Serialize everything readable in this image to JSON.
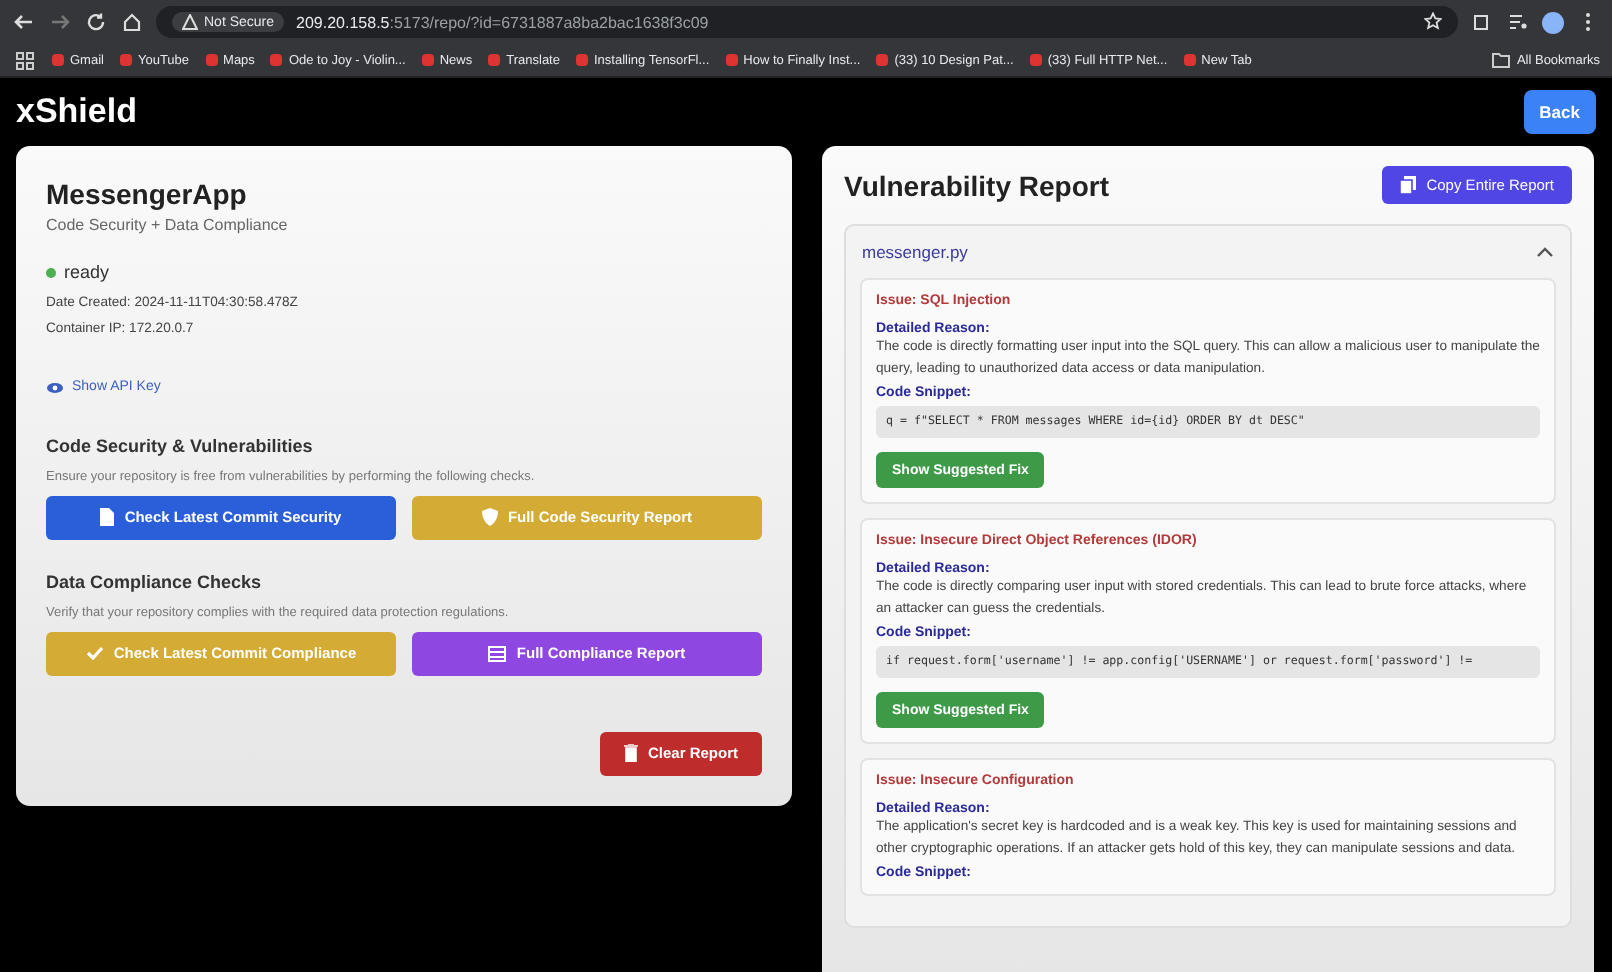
{
  "browser": {
    "security": "Not Secure",
    "url_host": "209.20.158.5",
    "url_rest": ":5173/repo/?id=6731887a8ba2bac1638f3c09",
    "bookmarks": [
      "Gmail",
      "YouTube",
      "Maps",
      "Ode to Joy - Violin...",
      "News",
      "Translate",
      "Installing TensorFl...",
      "How to Finally Inst...",
      "(33) 10 Design Pat...",
      "(33) Full HTTP Net...",
      "New Tab"
    ],
    "all_bookmarks": "All Bookmarks"
  },
  "header": {
    "brand": "xShield",
    "back": "Back"
  },
  "repo": {
    "name": "MessengerApp",
    "subtitle": "Code Security + Data Compliance",
    "status": "ready",
    "date_created": "Date Created: 2024-11-11T04:30:58.478Z",
    "container_ip": "Container IP: 172.20.0.7",
    "api_key_link": "Show API Key"
  },
  "sections": [
    {
      "title": "Code Security & Vulnerabilities",
      "description": "Ensure your repository is free from vulnerabilities by performing the following checks.",
      "buttons": [
        {
          "label": "Check Latest Commit Security",
          "kind": "blue"
        },
        {
          "label": "Full Code Security Report",
          "kind": "gold"
        }
      ]
    },
    {
      "title": "Data Compliance Checks",
      "description": "Verify that your repository complies with the required data protection regulations.",
      "buttons": [
        {
          "label": "Check Latest Commit Compliance",
          "kind": "gold"
        },
        {
          "label": "Full Compliance Report",
          "kind": "purple"
        }
      ]
    }
  ],
  "clear_button": "Clear Report",
  "report": {
    "title": "Vulnerability Report",
    "copy_button": "Copy Entire Report",
    "file": "messenger.py",
    "expanded": true,
    "issues": [
      {
        "title": "Issue: SQL Injection",
        "reason_label": "Detailed Reason:",
        "reason": "The code is directly formatting user input into the SQL query. This can allow a malicious user to manipulate the query, leading to unauthorized data access or data manipulation.",
        "snippet_label": "Code Snippet:",
        "snippet": "q = f\"SELECT * FROM messages WHERE id={id} ORDER BY dt DESC\"",
        "fix_button": "Show Suggested Fix"
      },
      {
        "title": "Issue: Insecure Direct Object References (IDOR)",
        "reason_label": "Detailed Reason:",
        "reason": "The code is directly comparing user input with stored credentials. This can lead to brute force attacks, where an attacker can guess the credentials.",
        "snippet_label": "Code Snippet:",
        "snippet": "if request.form['username'] != app.config['USERNAME'] or request.form['password'] !=",
        "fix_button": "Show Suggested Fix"
      },
      {
        "title": "Issue: Insecure Configuration",
        "reason_label": "Detailed Reason:",
        "reason": "The application's secret key is hardcoded and is a weak key. This key is used for maintaining sessions and other cryptographic operations. If an attacker gets hold of this key, they can manipulate sessions and data.",
        "snippet_label": "Code Snippet:"
      }
    ]
  }
}
